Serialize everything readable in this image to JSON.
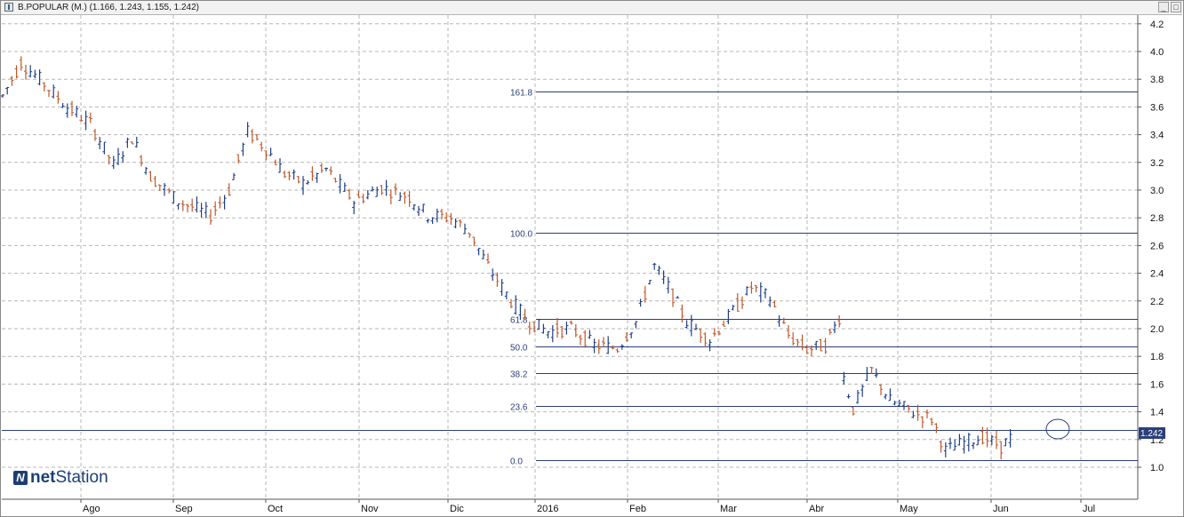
{
  "window": {
    "title": "B.POPULAR (M.) (1.166, 1.243, 1.155, 1.242)",
    "buttons": [
      "_",
      "□"
    ]
  },
  "logo": {
    "bold": "net",
    "rest": "Station"
  },
  "chart_data": {
    "type": "ohlc",
    "title": "B.POPULAR (M.) (1.166, 1.243, 1.155, 1.242)",
    "ylim": [
      0.9,
      4.3
    ],
    "yticks": [
      1.0,
      1.2,
      1.4,
      1.6,
      1.8,
      2.0,
      2.2,
      2.4,
      2.6,
      2.8,
      3.0,
      3.2,
      3.4,
      3.6,
      3.8,
      4.0,
      4.2
    ],
    "x_month_labels": [
      "Ago",
      "Sep",
      "Oct",
      "Nov",
      "Dic",
      "2016",
      "Feb",
      "Mar",
      "Abr",
      "May",
      "Jun",
      "Jul"
    ],
    "grid": true,
    "up_color": "#1f3f88",
    "down_color": "#c0582a",
    "last_value": "1.242",
    "last_value_color": "#2b3f7a",
    "fibonacci": [
      {
        "label": "161.8",
        "value": 3.71
      },
      {
        "label": "100.0",
        "value": 2.69
      },
      {
        "label": "61.8",
        "value": 2.07
      },
      {
        "label": "50.0",
        "value": 1.87
      },
      {
        "label": "38.2",
        "value": 1.68
      },
      {
        "label": "23.6",
        "value": 1.44
      },
      {
        "label": "0.0",
        "value": 1.05
      }
    ],
    "current_price_line": 1.27,
    "path_points": [
      [
        0,
        3.68
      ],
      [
        4,
        3.92
      ],
      [
        8,
        3.8
      ],
      [
        14,
        3.6
      ],
      [
        19,
        3.48
      ],
      [
        24,
        3.18
      ],
      [
        28,
        3.38
      ],
      [
        32,
        3.1
      ],
      [
        38,
        2.92
      ],
      [
        45,
        2.82
      ],
      [
        49,
        3.0
      ],
      [
        53,
        3.42
      ],
      [
        57,
        3.3
      ],
      [
        61,
        3.12
      ],
      [
        65,
        3.05
      ],
      [
        70,
        3.15
      ],
      [
        76,
        2.92
      ],
      [
        82,
        3.02
      ],
      [
        88,
        2.95
      ],
      [
        92,
        2.82
      ],
      [
        97,
        2.8
      ],
      [
        101,
        2.7
      ],
      [
        105,
        2.45
      ],
      [
        110,
        2.2
      ],
      [
        114,
        2.05
      ],
      [
        118,
        1.98
      ],
      [
        123,
        2.0
      ],
      [
        128,
        1.88
      ],
      [
        133,
        1.86
      ],
      [
        137,
        2.05
      ],
      [
        141,
        2.45
      ],
      [
        144,
        2.3
      ],
      [
        148,
        2.05
      ],
      [
        153,
        1.92
      ],
      [
        157,
        2.08
      ],
      [
        162,
        2.3
      ],
      [
        166,
        2.22
      ],
      [
        170,
        1.95
      ],
      [
        174,
        1.85
      ],
      [
        178,
        1.88
      ],
      [
        181,
        2.08
      ],
      [
        182,
        1.65
      ],
      [
        184,
        1.42
      ],
      [
        188,
        1.7
      ],
      [
        192,
        1.48
      ],
      [
        198,
        1.38
      ],
      [
        201,
        1.35
      ],
      [
        204,
        1.12
      ],
      [
        208,
        1.18
      ],
      [
        212,
        1.22
      ],
      [
        216,
        1.15
      ],
      [
        219,
        1.24
      ]
    ]
  }
}
